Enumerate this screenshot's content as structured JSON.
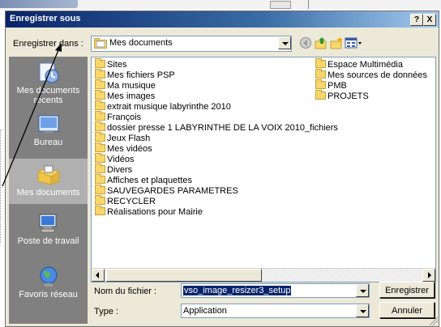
{
  "dialog": {
    "title": "Enregistrer sous",
    "help_label": "?",
    "close_label": "X"
  },
  "toolbar": {
    "lookin_label": "Enregistrer dans :",
    "location": "Mes documents",
    "icons": [
      "back-icon",
      "up-folder-icon",
      "new-folder-icon",
      "view-menu-icon"
    ]
  },
  "places": [
    {
      "label": "Mes documents récents",
      "icon": "recent-documents-icon"
    },
    {
      "label": "Bureau",
      "icon": "desktop-icon"
    },
    {
      "label": "Mes documents",
      "icon": "my-documents-icon",
      "active": true
    },
    {
      "label": "Poste de travail",
      "icon": "my-computer-icon"
    },
    {
      "label": "Favoris réseau",
      "icon": "network-places-icon"
    }
  ],
  "files_col1": [
    "Sites",
    "Mes fichiers PSP",
    "Ma musique",
    "Mes images",
    "extrait musique labyrinthe 2010",
    "François",
    "dossier presse 1 LABYRINTHE DE LA VOIX 2010_fichiers",
    "Jeux Flash",
    "Mes vidéos",
    "Vidéos",
    "Divers",
    "Affiches et plaquettes",
    "SAUVEGARDES PARAMETRES",
    "RECYCLER",
    "Réalisations pour Mairie"
  ],
  "files_col2": [
    "Espace Multimédia",
    "Mes sources de données",
    "PMB",
    "PROJETS"
  ],
  "form": {
    "filename_label": "Nom du fichier :",
    "filename_value": "vso_image_resizer3_setup",
    "type_label": "Type :",
    "type_value": "Application",
    "save_label": "Enregistrer",
    "cancel_label": "Annuler"
  },
  "colors": {
    "title_start": "#0a246a",
    "title_end": "#a6caf0",
    "dialog_bg": "#ece9d8",
    "places_bg": "#808080",
    "folder": "#f7d76a",
    "selection": "#0a246a"
  }
}
